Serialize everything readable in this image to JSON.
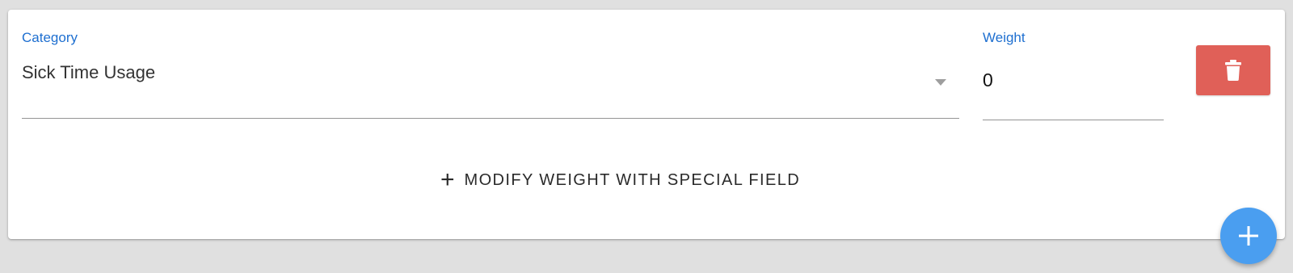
{
  "category": {
    "label": "Category",
    "value": "Sick Time Usage",
    "caret_icon": "dropdown-caret-icon"
  },
  "weight": {
    "label": "Weight",
    "value": "0"
  },
  "delete_button": {
    "icon": "trash-icon",
    "color": "#e06058"
  },
  "modify": {
    "icon": "plus",
    "label": "MODIFY WEIGHT WITH SPECIAL FIELD"
  },
  "fab": {
    "icon": "plus-icon",
    "color": "#4a9ef0"
  },
  "colors": {
    "accent_label": "#1e6fd0",
    "background": "#e0e0e0",
    "card": "#ffffff"
  }
}
